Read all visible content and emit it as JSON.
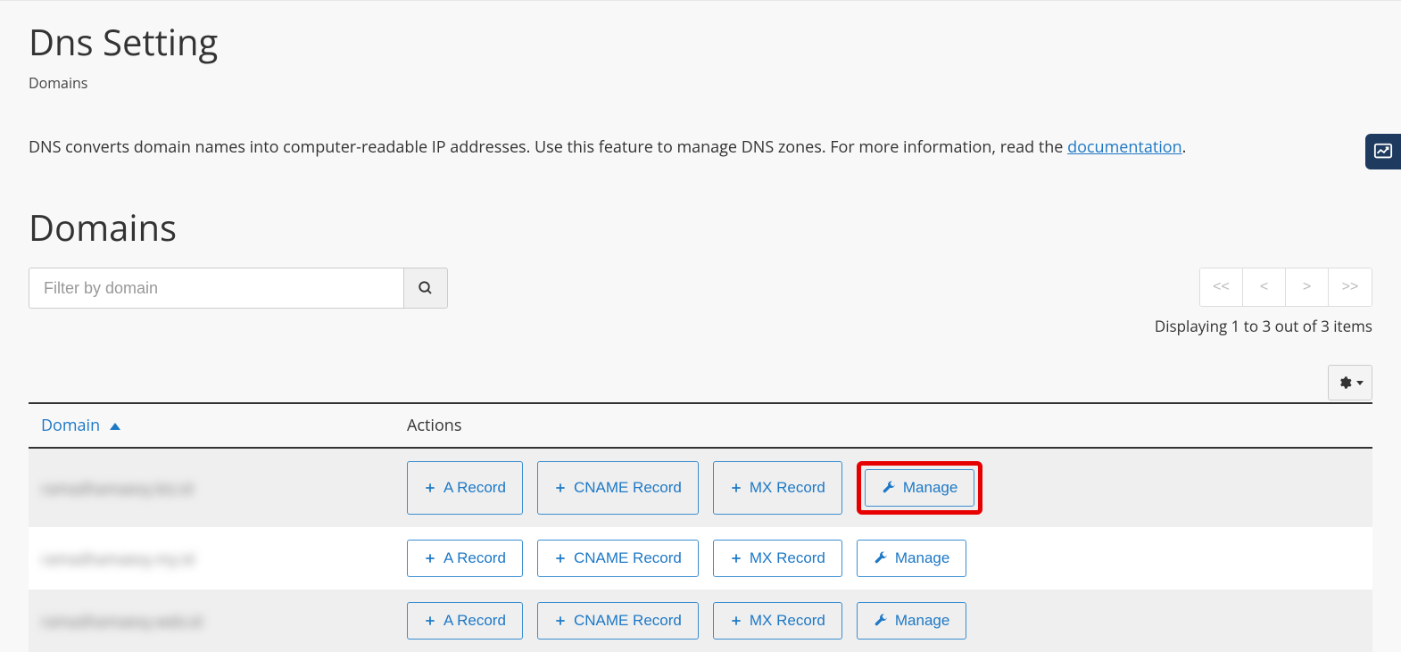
{
  "page_title": "Dns Setting",
  "breadcrumb": "Domains",
  "description_pre": "DNS converts domain names into computer-readable IP addresses. Use this feature to manage DNS zones. For more information, read the ",
  "description_link": "documentation",
  "description_post": ".",
  "section_title": "Domains",
  "filter_placeholder": "Filter by domain",
  "pager": {
    "first": "<<",
    "prev": "<",
    "next": ">",
    "last": ">>",
    "info": "Displaying 1 to 3 out of 3 items"
  },
  "table": {
    "col_domain": "Domain",
    "col_actions": "Actions",
    "btn_a": "A Record",
    "btn_cname": "CNAME Record",
    "btn_mx": "MX Record",
    "btn_manage": "Manage",
    "rows": [
      {
        "domain": "ramadhamaexy.biz.id",
        "highlight_manage": true
      },
      {
        "domain": "ramadhamaexy.my.id",
        "highlight_manage": false
      },
      {
        "domain": "ramadhamaexy.web.id",
        "highlight_manage": false
      }
    ]
  }
}
